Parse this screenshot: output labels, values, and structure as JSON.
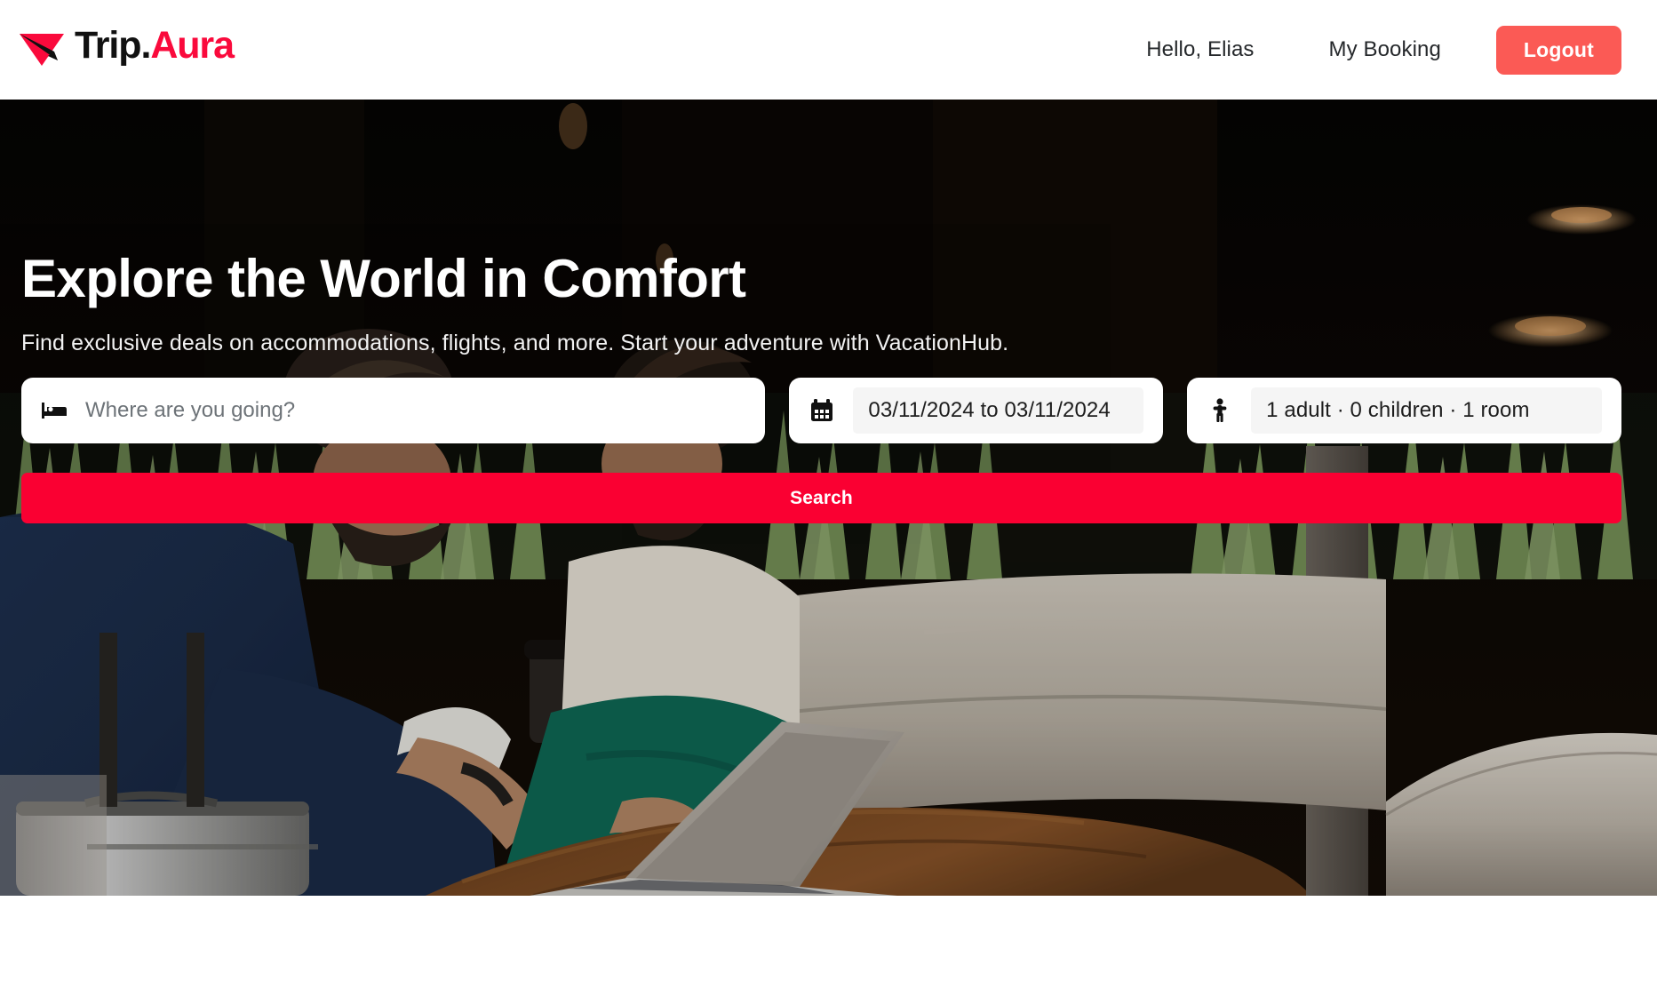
{
  "brand": {
    "name_primary": "Trip",
    "name_dot": ".",
    "name_accent": "Aura",
    "logo_icon": "paper-plane-icon",
    "accent_color": "#fa0a3c"
  },
  "header": {
    "greeting": "Hello, Elias",
    "my_booking": "My Booking",
    "logout": "Logout",
    "logout_color": "#fb5a55"
  },
  "hero": {
    "title": "Explore the World in Comfort",
    "subtitle": "Find exclusive deals on accommodations, flights, and more. Start your adventure with VacationHub.",
    "image_description": "Business man in navy suit with silver suitcase and woman in cream top and green trousers seated at a wooden table with an open laptop in a dark hotel lounge with green plants"
  },
  "search": {
    "destination": {
      "icon": "bed-icon",
      "placeholder": "Where are you going?",
      "value": ""
    },
    "dates": {
      "icon": "calendar-icon",
      "value": "03/11/2024 to 03/11/2024"
    },
    "guests": {
      "icon": "person-icon",
      "value": "1 adult · 0 children · 1 room"
    },
    "submit_label": "Search",
    "submit_color": "#fa0032"
  }
}
